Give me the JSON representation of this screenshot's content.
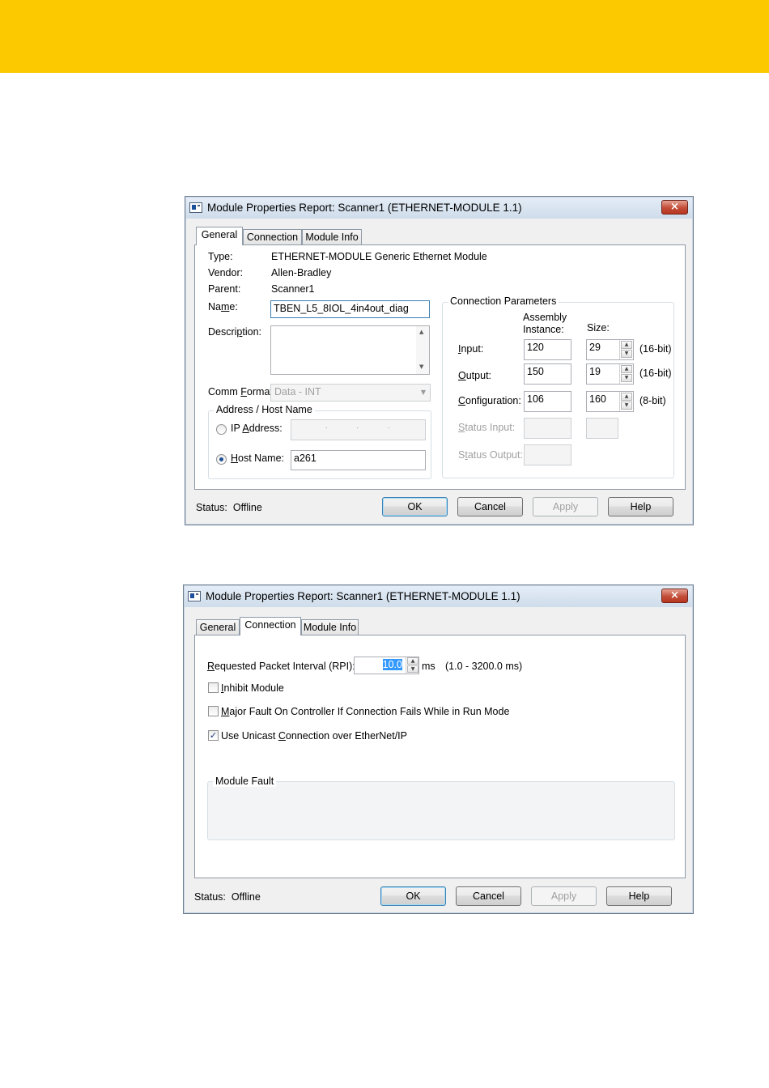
{
  "colors": {
    "brand_band": "#fcc800",
    "close_button": "#c24d38",
    "selection": "#3399ff"
  },
  "dialog_general": {
    "title": "Module Properties Report: Scanner1 (ETHERNET-MODULE 1.1)",
    "close_icon": "×",
    "tabs": [
      "General",
      "Connection",
      "Module Info"
    ],
    "active_tab": "General",
    "type_label": "Type:",
    "type_value": "ETHERNET-MODULE Generic Ethernet Module",
    "vendor_label": "Vendor:",
    "vendor_value": "Allen-Bradley",
    "parent_label": "Parent:",
    "parent_value": "Scanner1",
    "name_label_pre": "Na",
    "name_label_ul": "m",
    "name_label_post": "e:",
    "name_value": "TBEN_L5_8IOL_4in4out_diag",
    "description_label_pre": "Descri",
    "description_label_ul": "p",
    "description_label_post": "tion:",
    "description_value": "",
    "comm_format_label_pre": "Comm ",
    "comm_format_label_ul": "F",
    "comm_format_label_post": "ormat:",
    "comm_format_value": "Data - INT",
    "address_group_title": "Address / Host Name",
    "ip_label_pre": "IP ",
    "ip_label_ul": "A",
    "ip_label_post": "ddress:",
    "ip_selected": false,
    "host_label_pre": "",
    "host_label_ul": "H",
    "host_label_post": "ost Name:",
    "host_selected": true,
    "host_value": "a261",
    "conn_params": {
      "title": "Connection Parameters",
      "assembly_header_line1": "Assembly",
      "assembly_header_line2": "Instance:",
      "size_header": "Size:",
      "input_label_pre": "",
      "input_label_ul": "I",
      "input_label_post": "nput:",
      "input_instance": "120",
      "input_size": "29",
      "input_unit": "(16-bit)",
      "output_label_pre": "",
      "output_label_ul": "O",
      "output_label_post": "utput:",
      "output_instance": "150",
      "output_size": "19",
      "output_unit": "(16-bit)",
      "config_label_pre": "",
      "config_label_ul": "C",
      "config_label_post": "onfiguration:",
      "config_instance": "106",
      "config_size": "160",
      "config_unit": "(8-bit)",
      "status_input_label_pre": "",
      "status_input_label_ul": "S",
      "status_input_label_post": "tatus Input:",
      "status_output_label_pre": "S",
      "status_output_label_ul": "t",
      "status_output_label_post": "atus Output:"
    },
    "status_label": "Status:",
    "status_value": "Offline",
    "buttons": {
      "ok": "OK",
      "cancel": "Cancel",
      "apply": "Apply",
      "help": "Help"
    }
  },
  "dialog_connection": {
    "title": "Module Properties Report: Scanner1 (ETHERNET-MODULE 1.1)",
    "close_icon": "×",
    "tabs": [
      "General",
      "Connection",
      "Module Info"
    ],
    "active_tab": "Connection",
    "rpi_label_pre": "",
    "rpi_label_ul": "R",
    "rpi_label_post": "equested Packet Interval (RPI):",
    "rpi_value": "10.0",
    "rpi_unit": "ms",
    "rpi_range": "(1.0 - 3200.0 ms)",
    "inhibit_label_pre": "",
    "inhibit_label_ul": "I",
    "inhibit_label_post": "nhibit Module",
    "inhibit_checked": false,
    "major_fault_label_pre": "",
    "major_fault_label_ul": "M",
    "major_fault_label_post": "ajor Fault On Controller If Connection Fails While in Run Mode",
    "major_fault_checked": false,
    "unicast_label_pre": "Use Unicast ",
    "unicast_label_ul": "C",
    "unicast_label_post": "onnection over EtherNet/IP",
    "unicast_checked": true,
    "check_mark": "✓",
    "module_fault_title": "Module Fault",
    "status_label": "Status:",
    "status_value": "Offline",
    "buttons": {
      "ok": "OK",
      "cancel": "Cancel",
      "apply": "Apply",
      "help": "Help"
    }
  }
}
